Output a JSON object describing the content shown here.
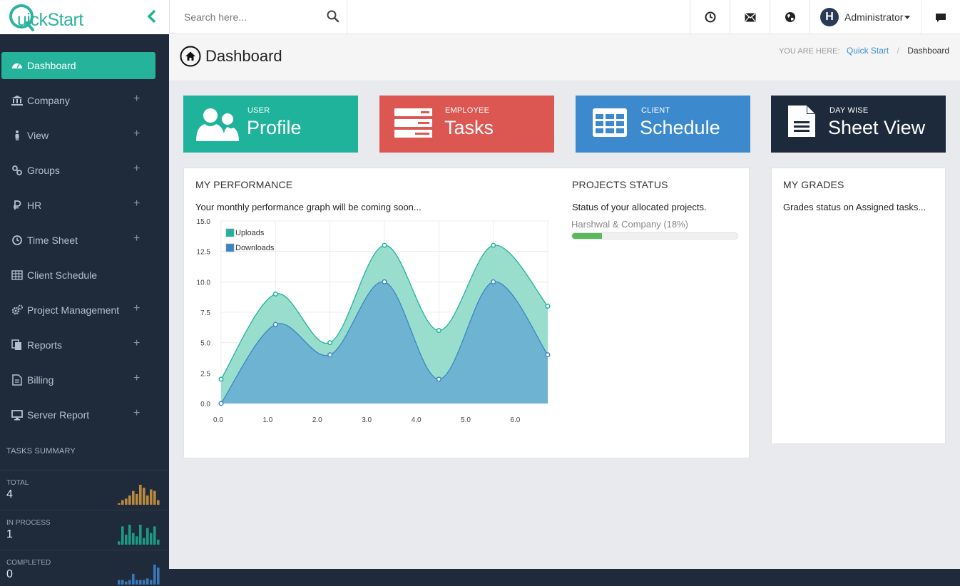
{
  "app": {
    "logo_text_q": "Q",
    "logo_text_rest": "uickStart"
  },
  "search": {
    "placeholder": "Search here..."
  },
  "user": {
    "name": "Administrator",
    "avatar_letter": "H"
  },
  "sidebar": {
    "items": [
      {
        "label": "Dashboard",
        "icon": "dashboard-icon",
        "expandable": false,
        "active": true
      },
      {
        "label": "Company",
        "icon": "bank-icon",
        "expandable": true
      },
      {
        "label": "View",
        "icon": "person-icon",
        "expandable": true
      },
      {
        "label": "Groups",
        "icon": "link-icon",
        "expandable": true
      },
      {
        "label": "HR",
        "icon": "ruble-icon",
        "expandable": true
      },
      {
        "label": "Time Sheet",
        "icon": "clock-icon",
        "expandable": true
      },
      {
        "label": "Client Schedule",
        "icon": "table-icon",
        "expandable": false
      },
      {
        "label": "Project Management",
        "icon": "gears-icon",
        "expandable": true
      },
      {
        "label": "Reports",
        "icon": "copy-icon",
        "expandable": true
      },
      {
        "label": "Billing",
        "icon": "file-icon",
        "expandable": true
      },
      {
        "label": "Server Report",
        "icon": "desktop-icon",
        "expandable": true
      }
    ],
    "plus_symbol": "+",
    "tasks_summary": {
      "title": "TASKS SUMMARY",
      "blocks": [
        {
          "label": "TOTAL",
          "value": "4",
          "color": "#b98a3e",
          "bars": [
            1,
            3,
            4,
            6,
            9,
            7,
            13,
            11,
            6,
            10,
            9,
            3
          ]
        },
        {
          "label": "IN PROCESS",
          "value": "1",
          "color": "#1c9a84",
          "bars": [
            2,
            11,
            6,
            12,
            7,
            5,
            12,
            4,
            10,
            7,
            11,
            3
          ]
        },
        {
          "label": "COMPLETED",
          "value": "0",
          "color": "#3a78b8",
          "bars": [
            3,
            3,
            2,
            3,
            7,
            3,
            3,
            3,
            4,
            3,
            13,
            11
          ]
        }
      ]
    }
  },
  "header": {
    "title": "Dashboard",
    "breadcrumb_prefix": "YOU ARE HERE:",
    "breadcrumb_link": "Quick Start",
    "breadcrumb_separator": "/",
    "breadcrumb_current": "Dashboard"
  },
  "tiles": [
    {
      "sub": "USER",
      "main": "Profile",
      "color": "#1fb39c",
      "icon": "users-icon"
    },
    {
      "sub": "EMPLOYEE",
      "main": "Tasks",
      "color": "#dc5752",
      "icon": "server-icon"
    },
    {
      "sub": "CLIENT",
      "main": "Schedule",
      "color": "#3d89cd",
      "icon": "grid-icon"
    },
    {
      "sub": "DAY WISE",
      "main": "Sheet View",
      "color": "#1d2a3b",
      "icon": "document-icon"
    }
  ],
  "performance": {
    "title": "MY PERFORMANCE",
    "description": "Your monthly performance graph will be coming soon..."
  },
  "projects": {
    "title": "PROJECTS STATUS",
    "description": "Status of your allocated projects.",
    "item_label": "Harshwal & Company (18%)",
    "progress": 0.18
  },
  "grades": {
    "title": "MY GRADES",
    "description": "Grades status on Assigned tasks..."
  },
  "chart_data": {
    "type": "area",
    "x": [
      0.0,
      1.1,
      2.2,
      3.3,
      4.4,
      5.5,
      6.6
    ],
    "xticks": [
      "0.0",
      "1.0",
      "2.0",
      "3.0",
      "4.0",
      "5.0",
      "6.0"
    ],
    "yticks": [
      "0.0",
      "2.5",
      "5.0",
      "7.5",
      "10.0",
      "12.5",
      "15.0"
    ],
    "xlim": [
      0,
      6.6
    ],
    "ylim": [
      0,
      15
    ],
    "grid": true,
    "legend": "top-left",
    "series": [
      {
        "name": "Uploads",
        "values": [
          2,
          9,
          5,
          13,
          6,
          13,
          8
        ],
        "color": "#1fb39c",
        "fill": "#93dcc9"
      },
      {
        "name": "Downloads",
        "values": [
          0,
          6.5,
          4,
          10,
          2,
          10,
          4
        ],
        "color": "#3a86c5",
        "fill": "#6db0d2"
      }
    ]
  }
}
